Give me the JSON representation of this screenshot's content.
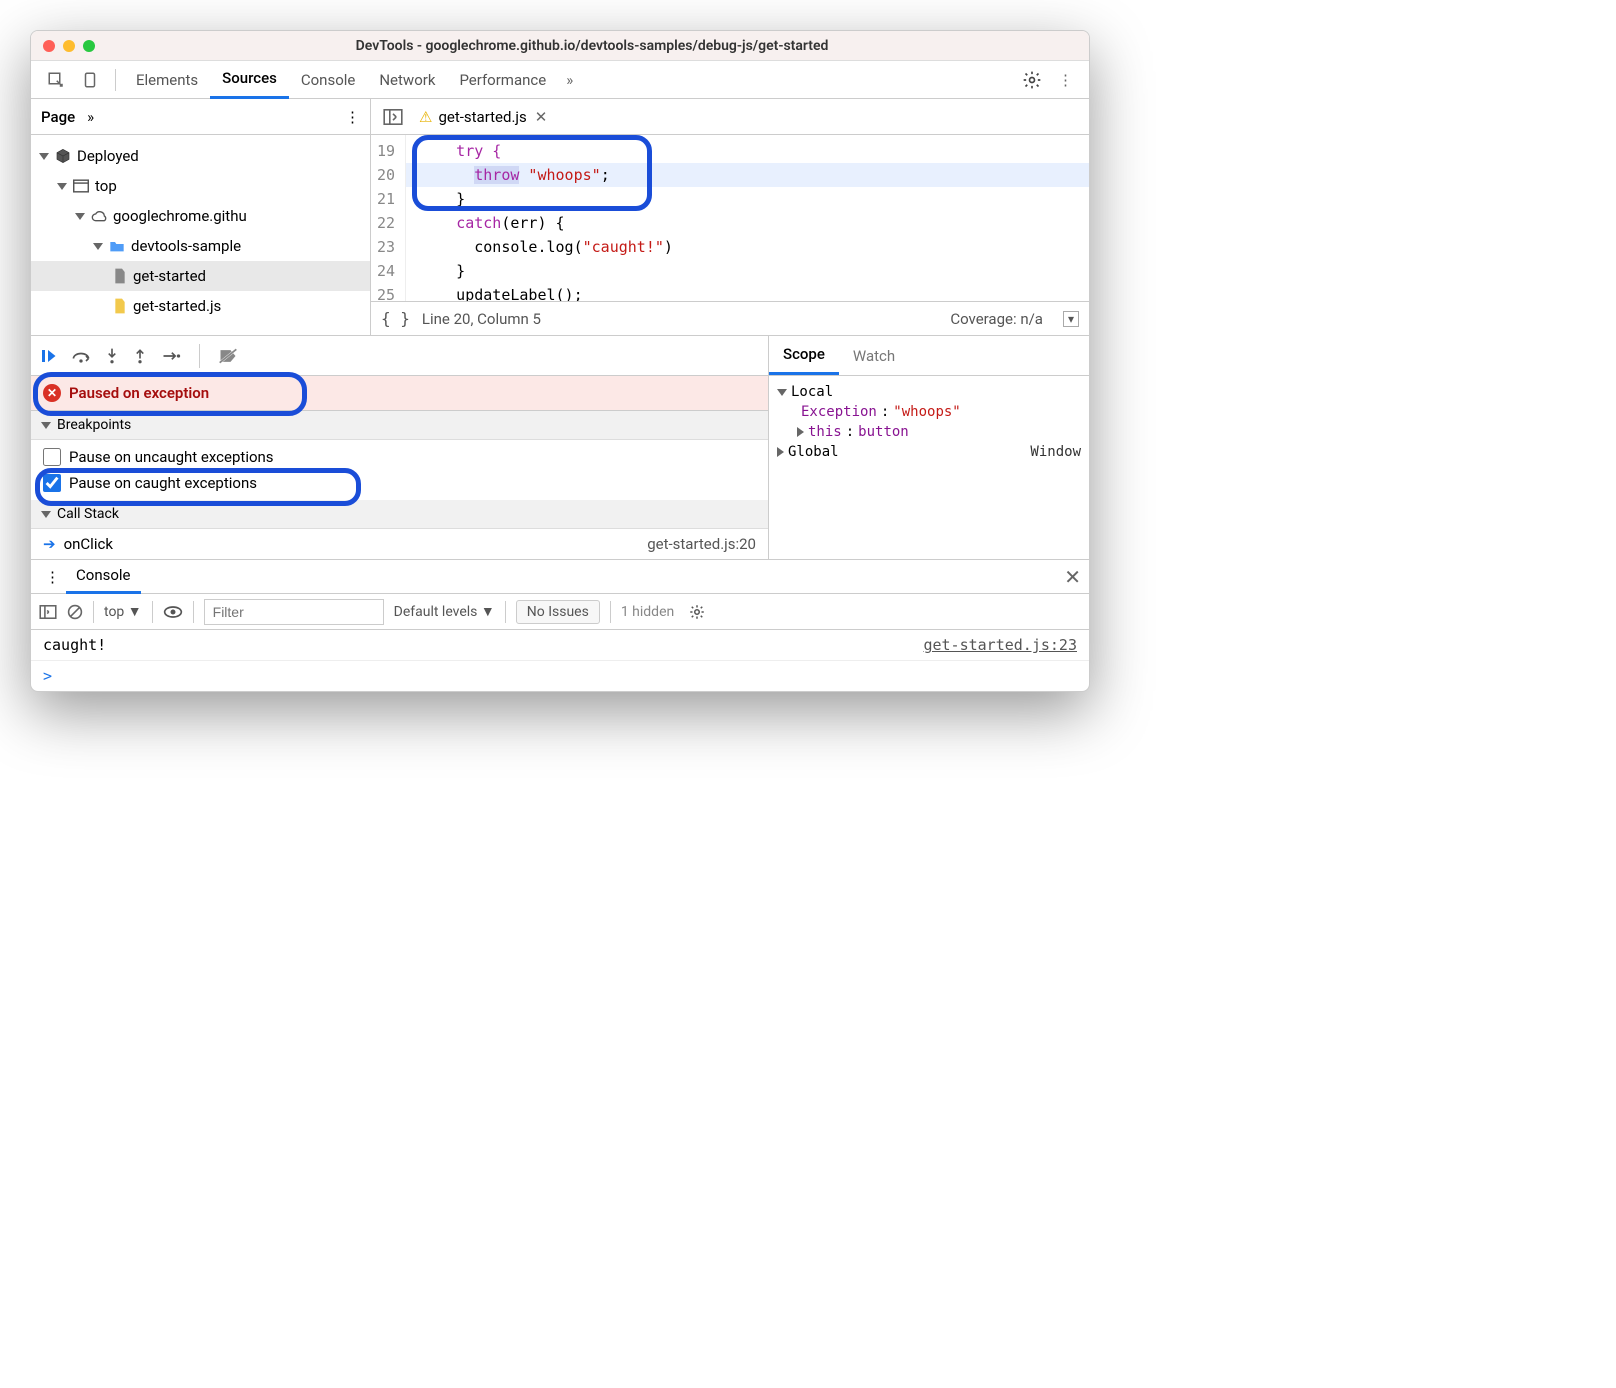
{
  "titlebar": {
    "title": "DevTools - googlechrome.github.io/devtools-samples/debug-js/get-started"
  },
  "top_tabs": {
    "elements": "Elements",
    "sources": "Sources",
    "console": "Console",
    "network": "Network",
    "performance": "Performance"
  },
  "nav_head": {
    "page": "Page"
  },
  "file_tab": {
    "name": "get-started.js"
  },
  "tree": {
    "deployed": "Deployed",
    "top": "top",
    "domain": "googlechrome.githu",
    "folder": "devtools-sample",
    "file1": "get-started",
    "file2": "get-started.js"
  },
  "code": {
    "lines": [
      "19",
      "20",
      "21",
      "22",
      "23",
      "24",
      "25"
    ],
    "l19": "    try {",
    "l20_kw": "throw",
    "l20_str": " \"whoops\"",
    "l20_end": ";",
    "l21": "    }",
    "l22_a": "    ",
    "l22_kw": "catch",
    "l22_b": "(err) {",
    "l23_a": "      console.log(",
    "l23_str": "\"caught!\"",
    "l23_b": ")",
    "l24": "    }",
    "l25": "    updateLabel();"
  },
  "editor_status": {
    "brackets": "{ }",
    "pos": "Line 20, Column 5",
    "coverage": "Coverage: n/a"
  },
  "paused": {
    "label": "Paused on exception"
  },
  "breakpoints": {
    "head": "Breakpoints",
    "uncaught": "Pause on uncaught exceptions",
    "caught": "Pause on caught exceptions"
  },
  "callstack": {
    "head": "Call Stack",
    "fn": "onClick",
    "loc": "get-started.js:20"
  },
  "scope": {
    "tab_scope": "Scope",
    "tab_watch": "Watch",
    "local": "Local",
    "ex_key": "Exception",
    "ex_val": "\"whoops\"",
    "this_key": "this",
    "this_val": "button",
    "global": "Global",
    "global_val": "Window"
  },
  "console": {
    "tab": "Console",
    "ctx": "top",
    "filter_ph": "Filter",
    "levels": "Default levels",
    "no_issues": "No Issues",
    "hidden": "1 hidden",
    "out": "caught!",
    "out_loc": "get-started.js:23",
    "prompt": ">"
  }
}
